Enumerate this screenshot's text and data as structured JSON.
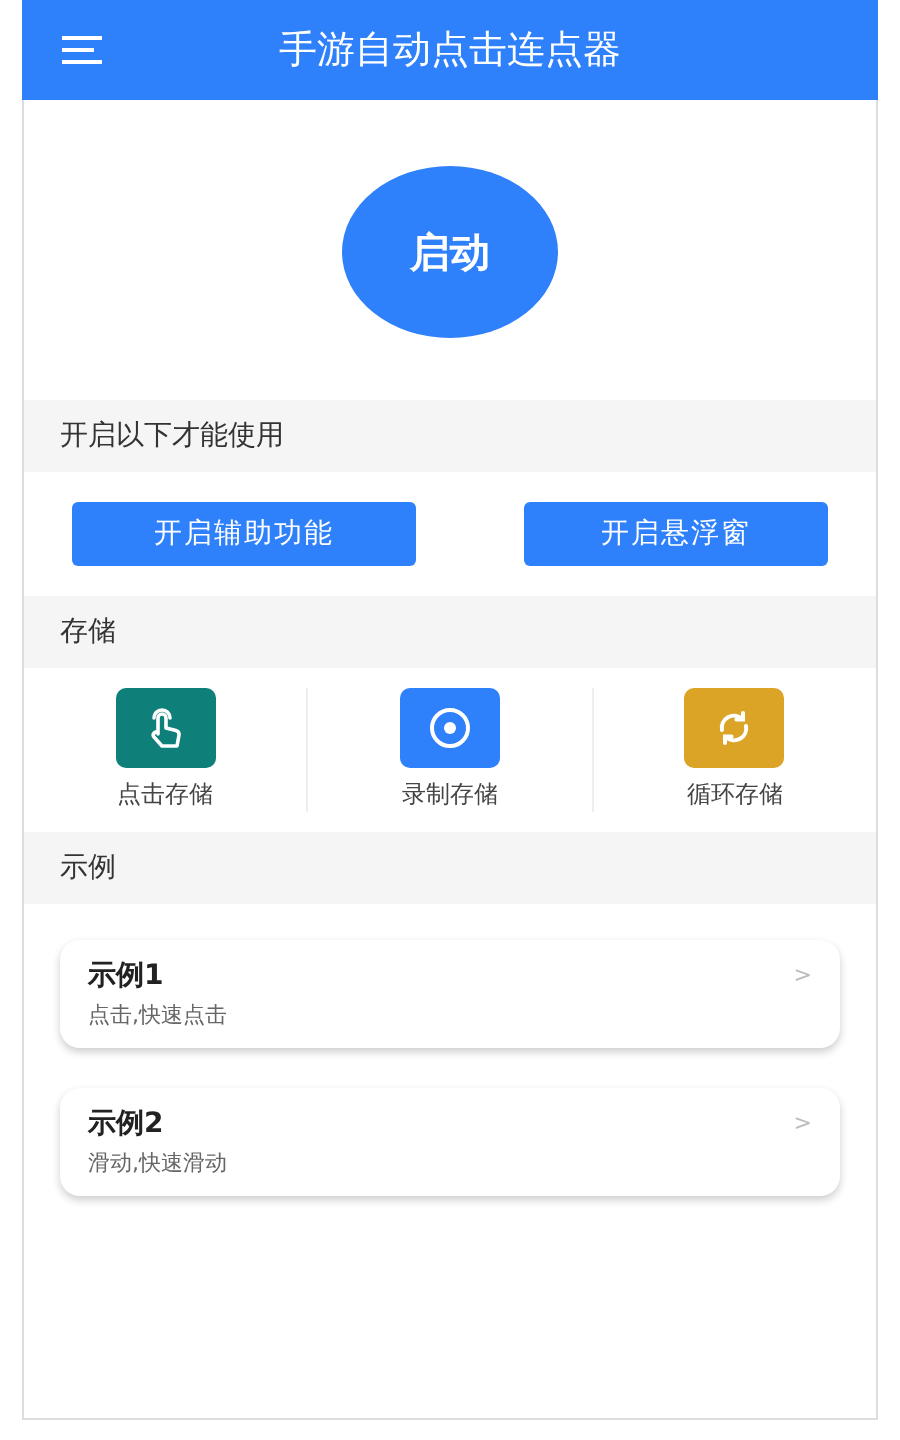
{
  "header": {
    "title": "手游自动点击连点器"
  },
  "start_button": {
    "label": "启动"
  },
  "permissions": {
    "heading": "开启以下才能使用",
    "buttons": [
      "开启辅助功能",
      "开启悬浮窗"
    ]
  },
  "storage": {
    "heading": "存储",
    "items": [
      {
        "label": "点击存储",
        "kind": "tap",
        "color": "#0f7f7a"
      },
      {
        "label": "录制存储",
        "kind": "record",
        "color": "#2f80fb"
      },
      {
        "label": "循环存储",
        "kind": "loop",
        "color": "#dba427"
      }
    ]
  },
  "examples": {
    "heading": "示例",
    "items": [
      {
        "title": "示例1",
        "subtitle": "点击,快速点击",
        "chevron": ">"
      },
      {
        "title": "示例2",
        "subtitle": "滑动,快速滑动",
        "chevron": ">"
      }
    ]
  }
}
